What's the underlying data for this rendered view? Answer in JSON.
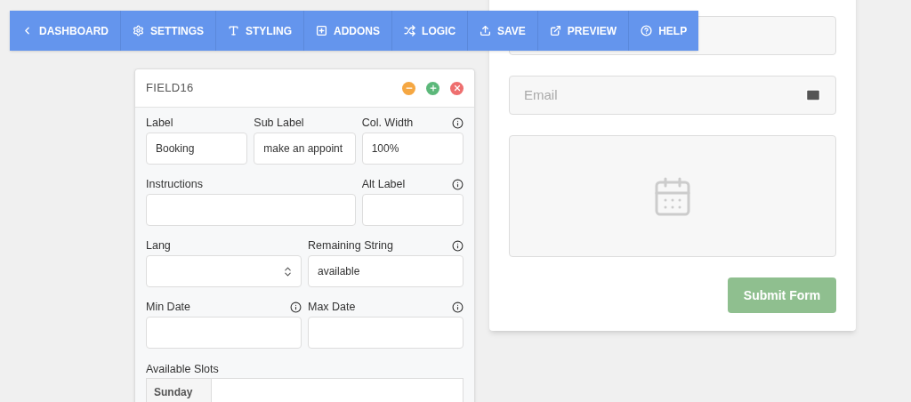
{
  "toolbar": [
    {
      "label": "DASHBOARD"
    },
    {
      "label": "SETTINGS"
    },
    {
      "label": "STYLING"
    },
    {
      "label": "ADDONS"
    },
    {
      "label": "LOGIC"
    },
    {
      "label": "SAVE"
    },
    {
      "label": "PREVIEW"
    },
    {
      "label": "HELP"
    }
  ],
  "field_panel": {
    "title": "FIELD16",
    "controls": [
      {
        "kind": "minimize"
      },
      {
        "kind": "add"
      },
      {
        "kind": "close"
      }
    ],
    "rows": [
      [
        {
          "label": "Label",
          "value": "Booking",
          "info": false,
          "kind": "text"
        },
        {
          "label": "Sub Label",
          "value": "make an appoint",
          "info": false,
          "kind": "text"
        },
        {
          "label": "Col. Width",
          "value": "100%",
          "info": true,
          "kind": "text"
        }
      ],
      [
        {
          "label": "Instructions",
          "info": false,
          "kind": "wide"
        },
        {
          "label": "Alt Label",
          "info": true,
          "kind": "text"
        }
      ],
      [
        {
          "label": "Lang",
          "info": false,
          "kind": "select"
        },
        {
          "label": "Remaining String",
          "value": "available",
          "info": true,
          "kind": "text"
        }
      ],
      [
        {
          "label": "Min Date",
          "info": true,
          "kind": "text"
        },
        {
          "label": "Max Date",
          "info": true,
          "kind": "text"
        }
      ]
    ],
    "slots": {
      "label": "Available Slots",
      "days": [
        "Sunday"
      ]
    }
  },
  "form": {
    "email_placeholder": "Email",
    "submit": "Submit Form"
  }
}
